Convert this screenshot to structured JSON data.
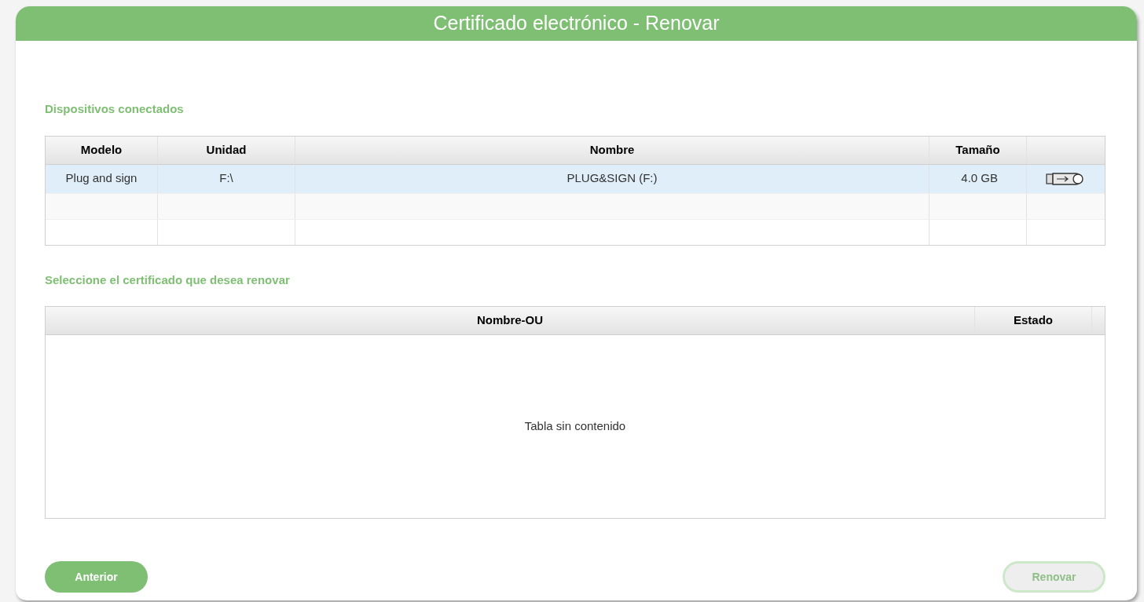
{
  "window": {
    "title": "Certificado electrónico - Renovar"
  },
  "devices": {
    "heading": "Dispositivos conectados",
    "columns": [
      "Modelo",
      "Unidad",
      "Nombre",
      "Tamaño"
    ],
    "rows": [
      {
        "cells": [
          "Plug and sign",
          "F:\\",
          "PLUG&SIGN (F:)",
          "4.0 GB"
        ],
        "selected": true
      }
    ]
  },
  "certificates": {
    "heading": "Seleccione el certificado que desea renovar",
    "columns": [
      "Nombre-OU",
      "Estado"
    ],
    "empty_message": "Tabla sin contenido"
  },
  "buttons": [
    {
      "label": "Anterior",
      "disabled": false
    },
    {
      "label": "Renovar",
      "disabled": true
    }
  ]
}
